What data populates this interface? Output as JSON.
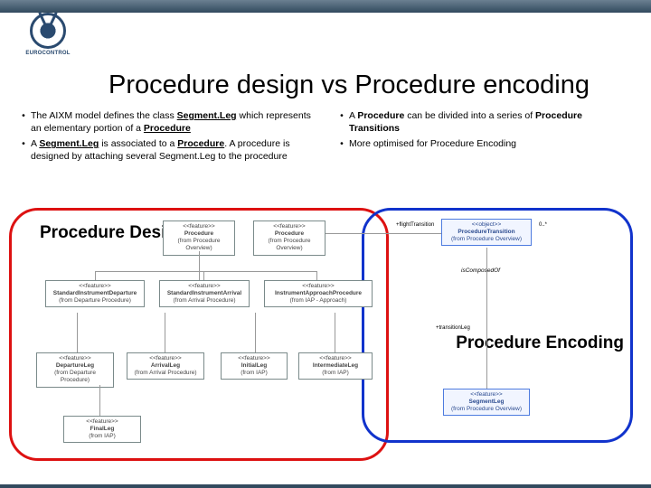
{
  "header": {
    "org_label": "EUROCONTROL"
  },
  "title": "Procedure design vs Procedure encoding",
  "left_bullets": {
    "items": [
      {
        "pre": "The AIXM model defines the class ",
        "key": "Segment.Leg",
        "post": " which represents an elementary portion of a ",
        "tail": "Procedure"
      },
      {
        "pre": "A ",
        "key": "Segment.Leg",
        "mid": " is associated to a ",
        "key2": "Procedure",
        "post": ". A procedure is designed by attaching several Segment.Leg to the procedure"
      }
    ]
  },
  "right_bullets": {
    "items": [
      {
        "pre": "A ",
        "key": "Procedure",
        "mid": " can be divided into a series of ",
        "key2": "Procedure Transitions"
      },
      {
        "plain": "More optimised for Procedure Encoding"
      }
    ]
  },
  "labels": {
    "design": "Procedure Design",
    "encoding": "Procedure Encoding"
  },
  "uml": {
    "procedure": {
      "stereo": "<<feature>>",
      "name": "Procedure",
      "note": "(from Procedure Overview)"
    },
    "procedure2": {
      "stereo": "<<feature>>",
      "name": "Procedure",
      "note": "(from Procedure Overview)"
    },
    "transition": {
      "stereo": "<<object>>",
      "name": "ProcedureTransition",
      "note": "(from Procedure Overview)"
    },
    "sid": {
      "stereo": "<<feature>>",
      "name": "StandardInstrumentDeparture",
      "note": "(from Departure Procedure)"
    },
    "arr": {
      "stereo": "<<feature>>",
      "name": "StandardInstrumentArrival",
      "note": "(from Arrival Procedure)"
    },
    "iap": {
      "stereo": "<<feature>>",
      "name": "InstrumentApproachProcedure",
      "note": "(from IAP - Approach)"
    },
    "segleg": {
      "stereo": "<<feature>>",
      "name": "SegmentLeg",
      "note": "(from Procedure Overview)"
    },
    "role_flight": "+flightTransition",
    "mult1": "0..*",
    "role_iscomposedof": "isComposedOf",
    "role_transition": "+transitionLeg",
    "dep_box1": {
      "stereo": "<<feature>>",
      "name": "DepartureLeg",
      "note": "(from Departure Procedure)"
    },
    "dep_box2": {
      "stereo": "<<feature>>",
      "name": "ArrivalLeg",
      "note": "(from Arrival Procedure)"
    },
    "app_box1": {
      "stereo": "<<feature>>",
      "name": "InitialLeg",
      "note": "(from IAP)"
    },
    "app_box2": {
      "stereo": "<<feature>>",
      "name": "IntermediateLeg",
      "note": "(from IAP)"
    },
    "app_box3": {
      "stereo": "<<feature>>",
      "name": "FinalLeg",
      "note": "(from IAP)"
    }
  }
}
